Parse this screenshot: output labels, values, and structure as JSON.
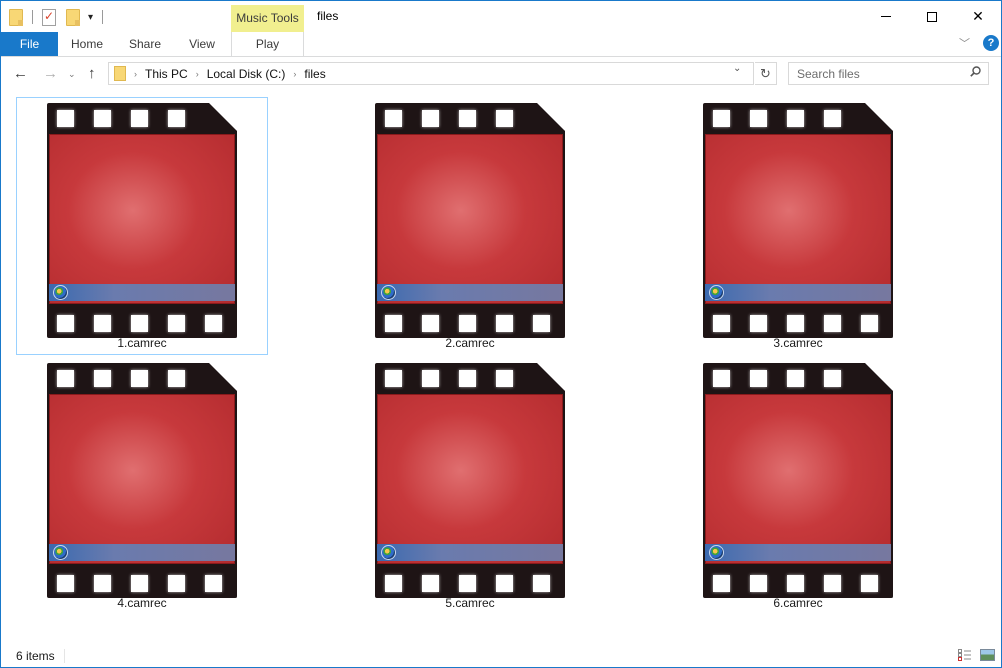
{
  "window": {
    "title": "files",
    "contextual_tab_group": "Music Tools",
    "caption": {
      "minimize": "Minimize",
      "maximize": "Maximize",
      "close": "✕"
    }
  },
  "quick_access": {
    "icons": [
      "folder-icon",
      "properties-icon",
      "new-folder-icon",
      "customize-dropdown-icon"
    ],
    "dropdown_glyph": "▾"
  },
  "ribbon": {
    "tabs": [
      {
        "label": "File",
        "active": true
      },
      {
        "label": "Home"
      },
      {
        "label": "Share"
      },
      {
        "label": "View"
      },
      {
        "label": "Play"
      }
    ],
    "expand_glyph": "﹀",
    "help_glyph": "?"
  },
  "navigation": {
    "back_glyph": "←",
    "forward_glyph": "→",
    "recent_glyph": "⌄",
    "up_glyph": "↑",
    "breadcrumb": [
      "This PC",
      "Local Disk (C:)",
      "files"
    ],
    "crumb_sep": "›",
    "dropdown_glyph": "⌄",
    "refresh_glyph": "↻"
  },
  "search": {
    "placeholder": "Search files",
    "value": ""
  },
  "files": [
    {
      "name": "1.camrec",
      "selected": true
    },
    {
      "name": "2.camrec"
    },
    {
      "name": "3.camrec"
    },
    {
      "name": "4.camrec"
    },
    {
      "name": "5.camrec"
    },
    {
      "name": "6.camrec"
    }
  ],
  "status": {
    "item_count": "6 items"
  },
  "colors": {
    "accent": "#1979ca",
    "contextual_tab": "#f1ef8f",
    "selection_border": "#99d1ff"
  }
}
